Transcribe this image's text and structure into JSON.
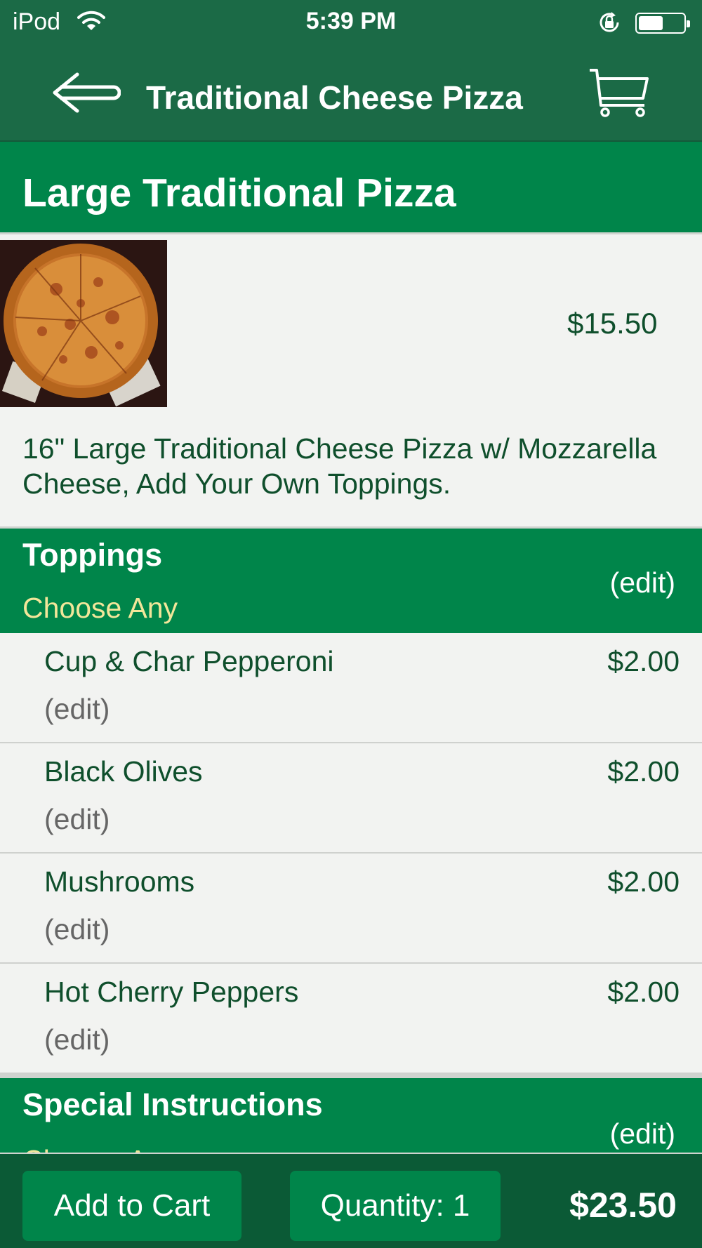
{
  "status_bar": {
    "carrier": "iPod",
    "time": "5:39 PM",
    "battery_level": 0.55
  },
  "nav": {
    "title": "Traditional Cheese Pizza",
    "back_icon": "back-arrow-icon",
    "cart_icon": "shopping-cart-icon"
  },
  "item": {
    "title": "Large Traditional Pizza",
    "price": "$15.50",
    "description": "16\" Large Traditional Cheese Pizza w/ Mozzarella Cheese, Add Your Own Toppings."
  },
  "toppings": {
    "title": "Toppings",
    "subtitle": "Choose Any",
    "edit_label": "(edit)",
    "items": [
      {
        "name": "Cup & Char Pepperoni",
        "price": "$2.00",
        "edit": "(edit)"
      },
      {
        "name": "Black Olives",
        "price": "$2.00",
        "edit": "(edit)"
      },
      {
        "name": "Mushrooms",
        "price": "$2.00",
        "edit": "(edit)"
      },
      {
        "name": "Hot Cherry Peppers",
        "price": "$2.00",
        "edit": "(edit)"
      }
    ]
  },
  "special": {
    "title": "Special Instructions",
    "subtitle": "Choose Any",
    "edit_label": "(edit)"
  },
  "bottom": {
    "add_to_cart": "Add to Cart",
    "quantity": "Quantity: 1",
    "total": "$23.50"
  },
  "colors": {
    "dark_green": "#1b6a46",
    "accent_green": "#00854a",
    "text_green": "#0f4f2c",
    "subtitle_yellow": "#f2e69a"
  }
}
